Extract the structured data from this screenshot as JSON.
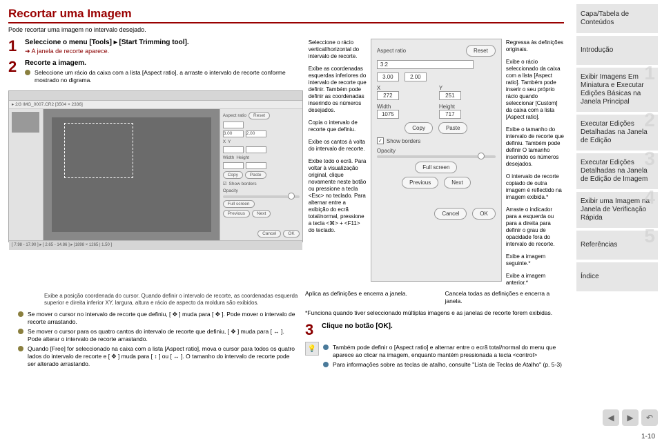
{
  "header": {
    "title": "Recortar uma Imagem",
    "subtitle": "Pode recortar uma imagem no intervalo desejado."
  },
  "steps": {
    "s1": {
      "head": "Seleccione o menu [Tools] ▸ [Start Trimming tool].",
      "sub": "A janela de recorte aparece."
    },
    "s2": {
      "head": "Recorte a imagem.",
      "bullet": "Seleccione um rácio da caixa com a lista [Aspect ratio], a arraste o intervalo de recorte conforme mostrado no digrama."
    },
    "s3": {
      "head": "Clique no botão [OK]."
    }
  },
  "callouts": {
    "c1": "Seleccione o rácio vertical/horizontal do intervalo de recorte.",
    "c2": "Exibe as coordenadas esquerdas inferiores do intervalo de recorte que definir. Também pode definir as coordenadas inserindo os números desejados.",
    "c3": "Copia o intervalo de recorte que definiu.",
    "c4": "Exibe os cantos à volta do intervalo de recorte.",
    "c5": "Exibe todo o ecrã. Para voltar à visualização original, clique novamente neste botão ou pressione a tecla <Esc> no teclado.\nPara alternar entre a exibição do ecrã total/normal, pressione a tecla <⌘> + <F11> do teclado.",
    "r1": "Regressa às definições originais.",
    "r2": "Exibe o rácio seleccionado da caixa com a lista [Aspect ratio]. Também pode inserir o seu próprio rácio quando seleccionar [Custom] da caixa com a lista [Aspect ratio].",
    "r3": "Exibe o tamanho do intervalo de recorte que definiu. Também pode definir O tamanho inserindo os números desejados.",
    "r4": "O intervalo de recorte copiado de outra imagem é reflectido na imagem exibida.*",
    "r5": "Arraste o indicador para a esquerda ou para a direita para definir o grau de opacidade fora do intervalo de recorte.",
    "r6": "Exibe a imagem seguinte.*",
    "r7": "Exibe a imagem anterior.*"
  },
  "panel": {
    "aspect_ratio_label": "Aspect ratio",
    "aspect_value": "3:2",
    "reset": "Reset",
    "ratio_a": "3.00",
    "ratio_b": "2.00",
    "x_label": "X",
    "y_label": "Y",
    "x_val": "272",
    "y_val": "251",
    "w_label": "Width",
    "h_label": "Height",
    "w_val": "1075",
    "h_val": "717",
    "copy": "Copy",
    "paste": "Paste",
    "show_borders": "Show borders",
    "opacity": "Opacity",
    "full_screen": "Full screen",
    "previous": "Previous",
    "next": "Next",
    "cancel": "Cancel",
    "ok": "OK"
  },
  "below": {
    "apply": "Aplica as definições e encerra a janela.",
    "cancel": "Cancela todas as definições e encerra a janela.",
    "footnote": "*Funciona quando tiver seleccionado múltiplas imagens e as janelas de recorte forem exibidas.",
    "cursor_note": "Exibe a posição coordenada do cursor.\nQuando definir o intervalo de recorte, as coordenadas esquerda superior e direita inferior XY, largura, altura e rácio de aspecto da moldura são exibidos.",
    "b1": "Se mover o cursor no intervalo de recorte que definiu, [ ✥ ] muda para [ ✥ ]. Pode mover o intervalo de recorte arrastando.",
    "b2": "Se mover o cursor para os quatro cantos do intervalo de recorte que definiu, [ ✥ ] muda para [ ↔ ]. Pode alterar o intervalo de recorte arrastando.",
    "b3": "Quando [Free] for seleccionado na caixa com a lista [Aspect ratio], mova o cursor para todos os quatro lados do intervalo de recorte e [ ✥ ] muda para [ ↕ ] ou [ ↔ ]. O tamanho do intervalo de recorte pode ser alterado arrastando.",
    "hint1": "Também pode definir o [Aspect ratio] e alternar entre o ecrã total/normal do menu que aparece ao clicar na imagem, enquanto mantém pressionada a tecla <control>",
    "hint2": "Para informações sobre as teclas de atalho, consulte \"Lista de Teclas de Atalho\" (p. 5-3)"
  },
  "ss": {
    "crumbs": "▸ 2/3 IMG_0007.CR2 [3504 × 2336]",
    "status": "[ 7.98 - 17.90 ] ▸ [ 2.65 - 14.86 ] ▸ [1898 × 1265 | 1.50 ]"
  },
  "tabs": {
    "t0": "Capa/Tabela de Conteúdos",
    "t1": "Introdução",
    "t2": "Exibir Imagens Em Miniatura e Executar Edições Básicas na Janela Principal",
    "t3": "Executar Edições Detalhadas na Janela de Edição",
    "t4": "Executar Edições Detalhadas na Janela de Edição de Imagem",
    "t5": "Exibir uma Imagem na Janela de Verificação Rápida",
    "t6": "Referências",
    "t7": "Índice"
  },
  "page": "1-10"
}
